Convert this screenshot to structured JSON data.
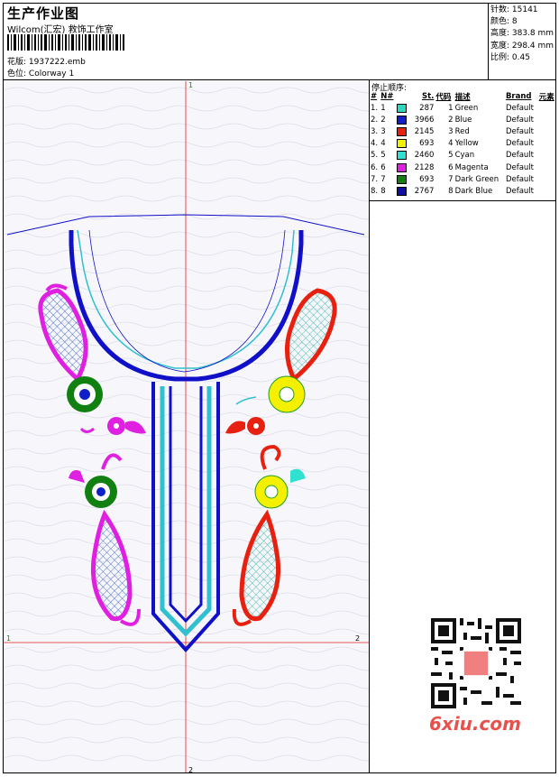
{
  "header": {
    "title": "生产作业图",
    "studio": "Wilcom(汇宏) 救饰工作室",
    "pattern_label": "花版:",
    "pattern_value": "1937222.emb",
    "colorway_label": "色位:",
    "colorway_value": "Colorway 1"
  },
  "specs": {
    "stitches": "针数: 15141",
    "colors": "颜色: 8",
    "height": "高度: 383.8 mm",
    "width": "宽度: 298.4 mm",
    "scale": "比例: 0.45"
  },
  "stop_sequence": {
    "title": "停止顺序:",
    "headers": [
      "#",
      "N#",
      "St.",
      "代码",
      "描述",
      "Brand",
      "元素"
    ],
    "rows": [
      {
        "idx": "1.",
        "n": "1",
        "color": "#2fd6c0",
        "st": "287",
        "code": "1",
        "desc": "Green",
        "brand": "Default"
      },
      {
        "idx": "2.",
        "n": "2",
        "color": "#1020c8",
        "st": "3966",
        "code": "2",
        "desc": "Blue",
        "brand": "Default"
      },
      {
        "idx": "3.",
        "n": "3",
        "color": "#e82010",
        "st": "2145",
        "code": "3",
        "desc": "Red",
        "brand": "Default"
      },
      {
        "idx": "4.",
        "n": "4",
        "color": "#f4f000",
        "st": "693",
        "code": "4",
        "desc": "Yellow",
        "brand": "Default"
      },
      {
        "idx": "5.",
        "n": "5",
        "color": "#30e0d0",
        "st": "2460",
        "code": "5",
        "desc": "Cyan",
        "brand": "Default"
      },
      {
        "idx": "6.",
        "n": "6",
        "color": "#e020e0",
        "st": "2128",
        "code": "6",
        "desc": "Magenta",
        "brand": "Default"
      },
      {
        "idx": "7.",
        "n": "7",
        "color": "#108010",
        "st": "693",
        "code": "7",
        "desc": "Dark Green",
        "brand": "Default"
      },
      {
        "idx": "8.",
        "n": "8",
        "color": "#1010a0",
        "st": "2767",
        "code": "8",
        "desc": "Dark Blue",
        "brand": "Default"
      }
    ]
  },
  "axis": {
    "top": "1",
    "bottom": "2",
    "left": "1",
    "right": "2"
  },
  "watermark": "6xiu.com",
  "colors": {
    "guide": "#e02020",
    "outline": "#1010c8",
    "background_pattern": "#d8d8e8"
  }
}
